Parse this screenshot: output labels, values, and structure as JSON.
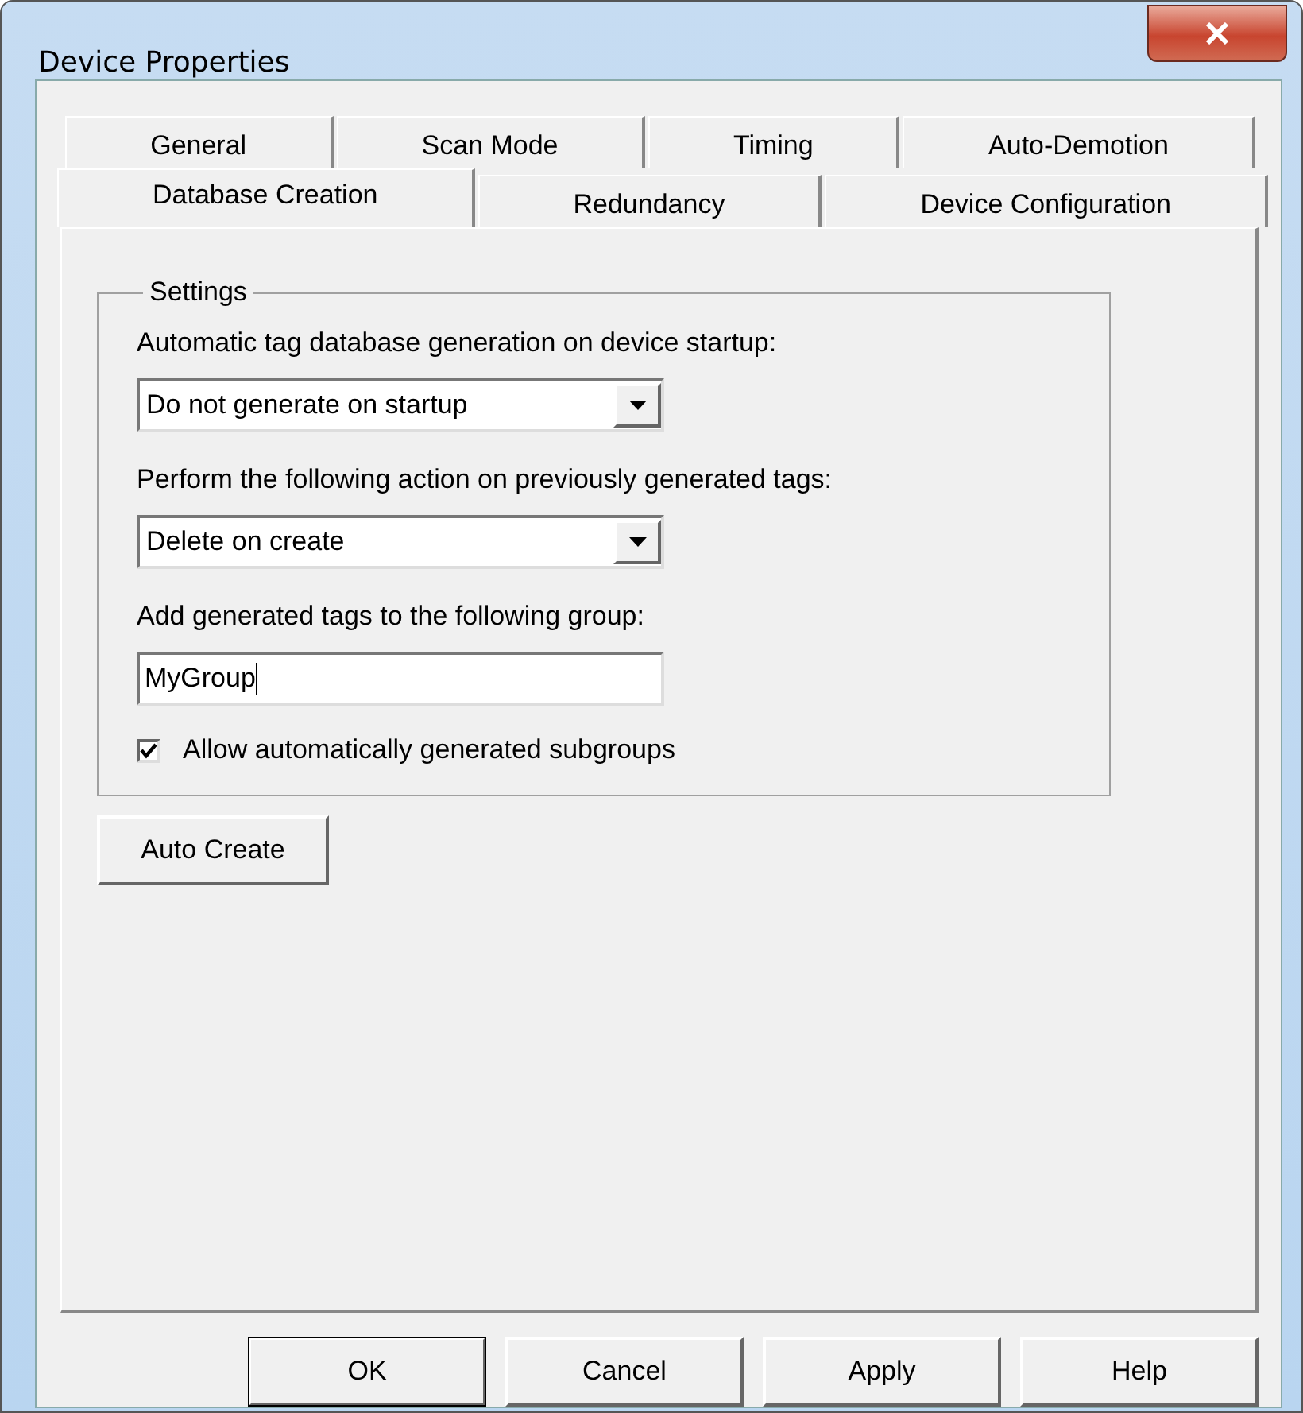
{
  "window": {
    "title": "Device Properties"
  },
  "tab_rows": [
    [
      {
        "label": "General",
        "selected": false
      },
      {
        "label": "Scan Mode",
        "selected": false
      },
      {
        "label": "Timing",
        "selected": false
      },
      {
        "label": "Auto-Demotion",
        "selected": false
      }
    ],
    [
      {
        "label": "Database Creation",
        "selected": true
      },
      {
        "label": "Redundancy",
        "selected": false
      },
      {
        "label": "Device Configuration",
        "selected": false
      }
    ]
  ],
  "settings": {
    "title": "Settings",
    "fields": [
      {
        "kind": "dropdown",
        "label": "Automatic tag database generation on device startup:",
        "value": "Do not generate on startup"
      },
      {
        "kind": "dropdown",
        "label": "Perform the following action on previously generated tags:",
        "value": "Delete on create"
      },
      {
        "kind": "text",
        "label": "Add generated tags to the following group:",
        "value": "MyGroup"
      }
    ],
    "checkbox": {
      "label": "Allow automatically generated subgroups",
      "checked": true
    }
  },
  "auto_create_button": "Auto Create",
  "buttons": [
    {
      "label": "OK",
      "default": true
    },
    {
      "label": "Cancel",
      "default": false
    },
    {
      "label": "Apply",
      "default": false
    },
    {
      "label": "Help",
      "default": false
    }
  ]
}
